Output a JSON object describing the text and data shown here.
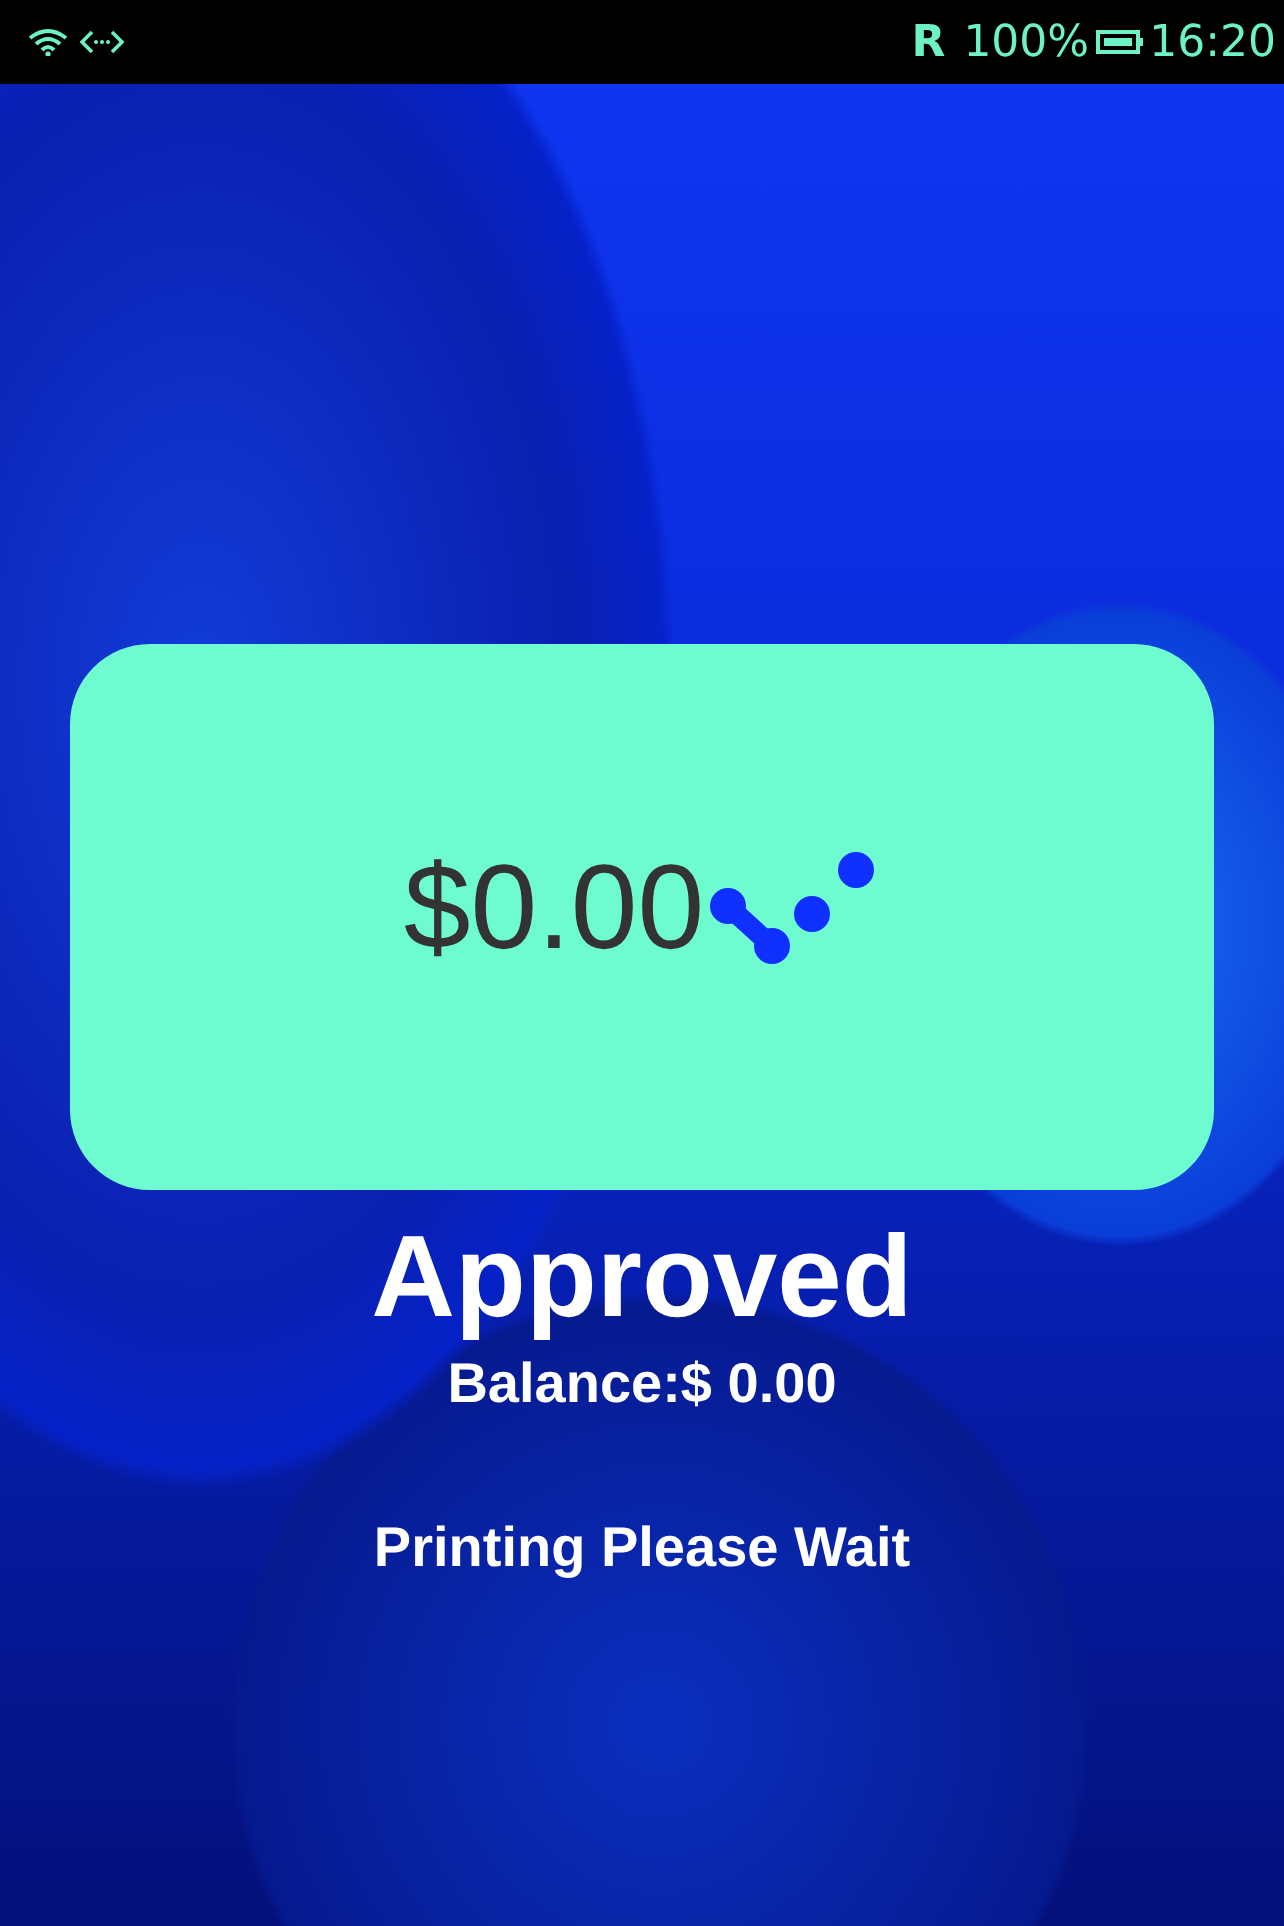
{
  "status_bar": {
    "roaming": "R",
    "battery_percent": "100%",
    "time": "16:20"
  },
  "amount_card": {
    "amount": "$0.00"
  },
  "status": "Approved",
  "balance": "Balance:$ 0.00",
  "message": "Printing Please Wait"
}
